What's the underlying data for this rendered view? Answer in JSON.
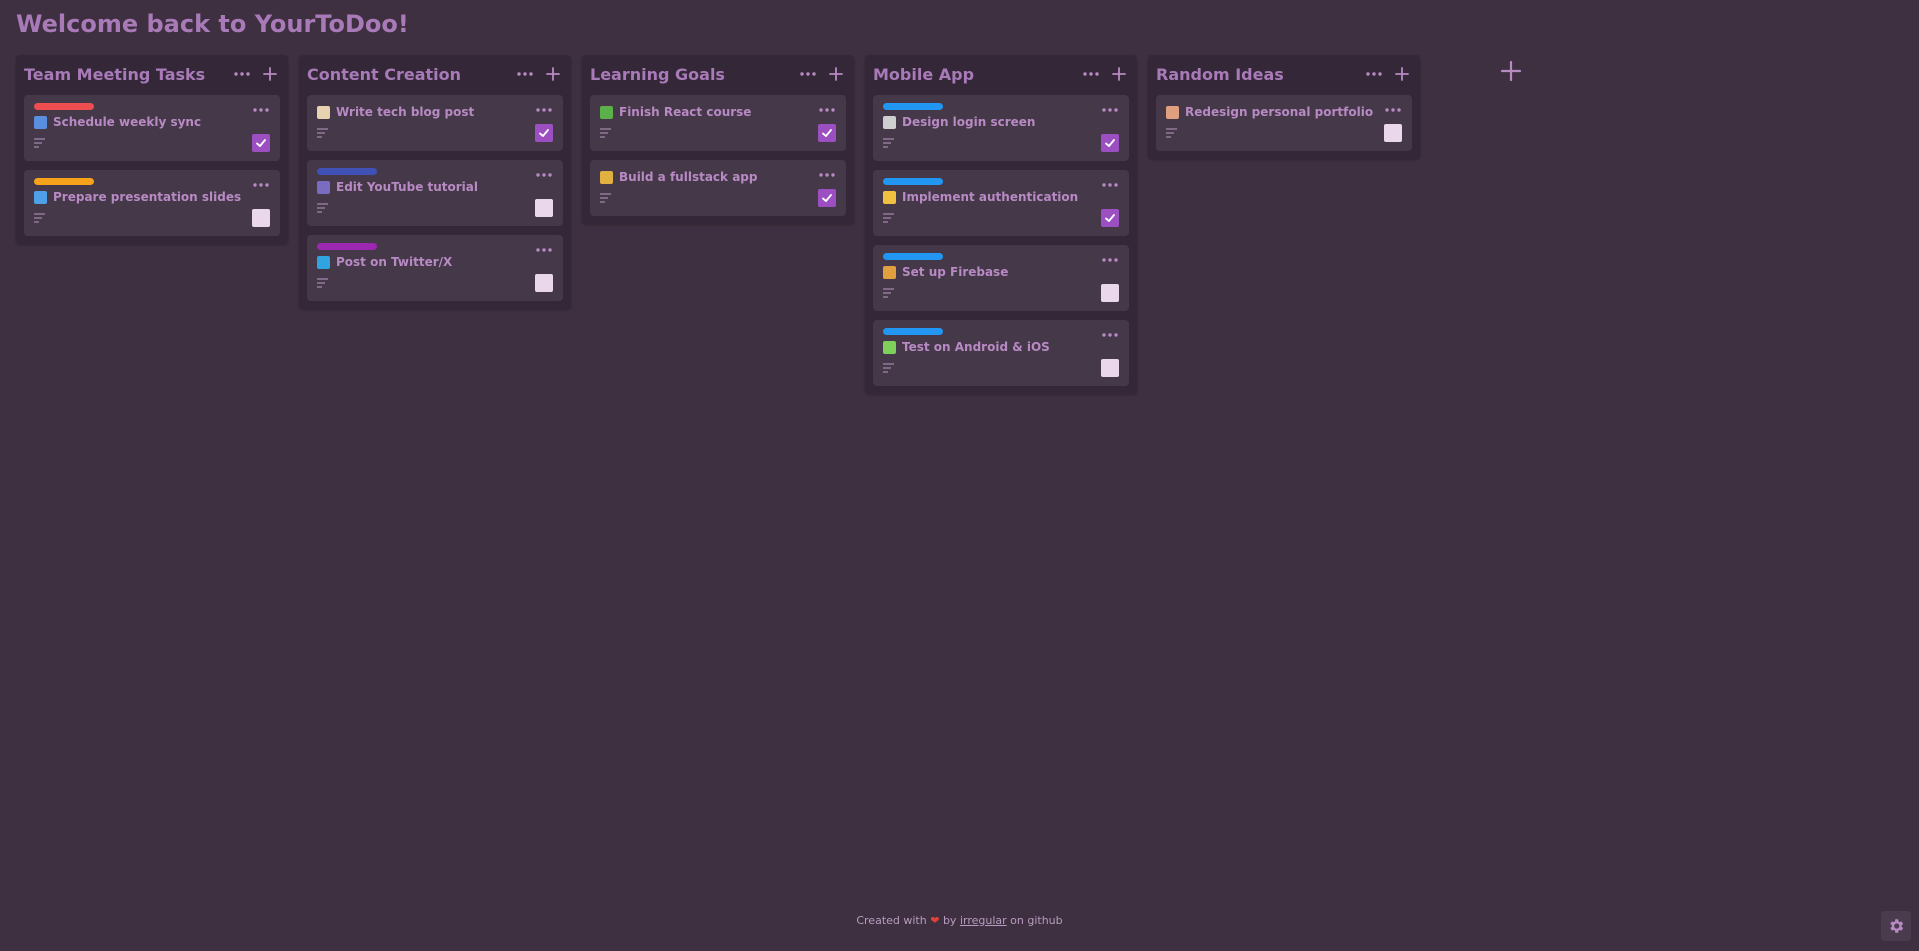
{
  "app": {
    "heading": "Welcome back to YourToDoo!"
  },
  "columns": [
    {
      "title": "Team Meeting Tasks",
      "cards": [
        {
          "title": "Schedule weekly sync",
          "label_color": "#ef4e50",
          "emoji": "calendar",
          "emoji_color": "#5a8fe0",
          "done": true
        },
        {
          "title": "Prepare presentation slides",
          "label_color": "#f7a21b",
          "emoji": "bar-chart",
          "emoji_color": "#4ea0e8",
          "done": false
        }
      ]
    },
    {
      "title": "Content Creation",
      "cards": [
        {
          "title": "Write tech blog post",
          "label_color": null,
          "emoji": "memo",
          "emoji_color": "#e8d3b0",
          "done": true
        },
        {
          "title": "Edit YouTube tutorial",
          "label_color": "#3f51b5",
          "emoji": "film",
          "emoji_color": "#7a6cc0",
          "done": false
        },
        {
          "title": "Post on Twitter/X",
          "label_color": "#9c27b0",
          "emoji": "bird",
          "emoji_color": "#2fa4e0",
          "done": false
        }
      ]
    },
    {
      "title": "Learning Goals",
      "cards": [
        {
          "title": "Finish React course",
          "label_color": null,
          "emoji": "books",
          "emoji_color": "#5bb04a",
          "done": true
        },
        {
          "title": "Build a fullstack app",
          "label_color": null,
          "emoji": "technologist",
          "emoji_color": "#e0b040",
          "done": true
        }
      ]
    },
    {
      "title": "Mobile App",
      "cards": [
        {
          "title": "Design login screen",
          "label_color": "#2196f3",
          "emoji": "phone",
          "emoji_color": "#cfcfcf",
          "done": true
        },
        {
          "title": "Implement authentication",
          "label_color": "#2196f3",
          "emoji": "lock",
          "emoji_color": "#f0c040",
          "done": true
        },
        {
          "title": "Set up Firebase",
          "label_color": "#2196f3",
          "emoji": "package",
          "emoji_color": "#e0a040",
          "done": false
        },
        {
          "title": "Test on Android & iOS",
          "label_color": "#2196f3",
          "emoji": "test-tube",
          "emoji_color": "#7ed05a",
          "done": false
        }
      ]
    },
    {
      "title": "Random Ideas",
      "cards": [
        {
          "title": "Redesign personal portfolio",
          "label_color": null,
          "emoji": "palette",
          "emoji_color": "#e0a080",
          "done": false
        }
      ]
    }
  ],
  "footer": {
    "prefix": "Created with",
    "by": "by",
    "author": "irregular",
    "suffix": "on github"
  },
  "icons": {
    "more": "more-horizontal-icon",
    "add": "plus-icon",
    "description": "description-lines-icon",
    "check": "checkmark-icon",
    "settings": "gear-icon"
  },
  "colors": {
    "background": "#3e3040",
    "column": "#342838",
    "card": "#453848",
    "accent": "#9b4fc0",
    "text": "#b88ac4"
  }
}
